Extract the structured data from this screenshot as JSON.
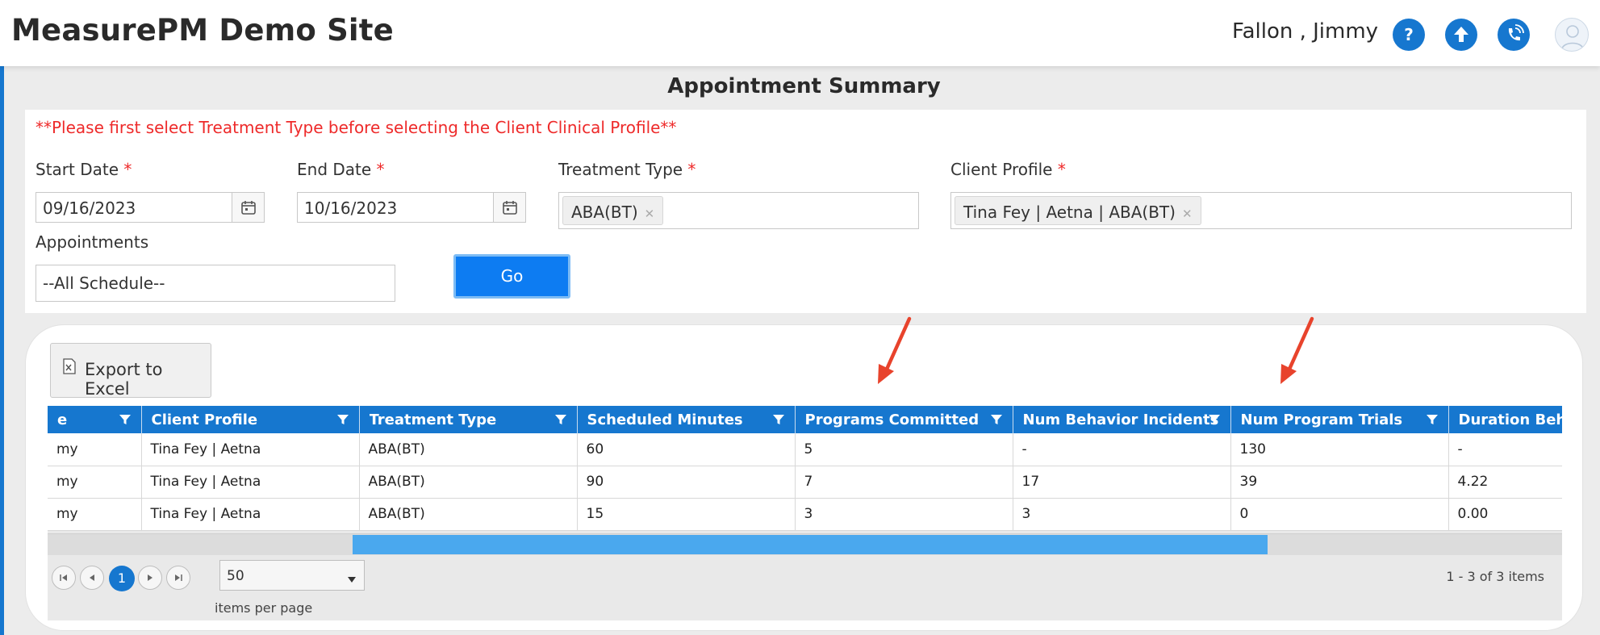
{
  "header": {
    "app_title": "MeasurePM Demo Site",
    "user_name": "Fallon , Jimmy",
    "icons": [
      "help-icon",
      "upload-icon",
      "phone-icon",
      "user-avatar-icon"
    ]
  },
  "form": {
    "title": "Appointment Summary",
    "warning": "**Please first select Treatment Type before selecting the Client Clinical Profile**",
    "start_date": {
      "label": "Start Date",
      "required": "*",
      "value": "09/16/2023"
    },
    "end_date": {
      "label": "End Date",
      "required": "*",
      "value": "10/16/2023"
    },
    "treatment_type": {
      "label": "Treatment Type",
      "required": "*",
      "chip": "ABA(BT)"
    },
    "client_profile": {
      "label": "Client Profile",
      "required": "*",
      "chip": "Tina Fey | Aetna | ABA(BT)"
    },
    "appointments": {
      "label": "Appointments",
      "value": "--All Schedule--"
    },
    "go_label": "Go"
  },
  "grid": {
    "export_label": "Export to Excel",
    "columns": [
      "e",
      "Client Profile",
      "Treatment Type",
      "Scheduled Minutes",
      "Programs Committed",
      "Num Behavior Incidents",
      "Num Program Trials",
      "Duration Behav"
    ],
    "rows": [
      [
        "my",
        "Tina Fey | Aetna",
        "ABA(BT)",
        "60",
        "5",
        "-",
        "130",
        "-"
      ],
      [
        "my",
        "Tina Fey | Aetna",
        "ABA(BT)",
        "90",
        "7",
        "17",
        "39",
        "4.22"
      ],
      [
        "my",
        "Tina Fey | Aetna",
        "ABA(BT)",
        "15",
        "3",
        "3",
        "0",
        "0.00"
      ]
    ],
    "pager": {
      "current_page": "1",
      "page_size": "50",
      "items_per_page": "items per page",
      "info": "1 - 3 of 3 items"
    }
  },
  "colors": {
    "brand_blue": "#1677cf",
    "go_button": "#0d7cf2",
    "warning_red": "#ee2a2a",
    "annotation_arrow": "#e8432c"
  }
}
